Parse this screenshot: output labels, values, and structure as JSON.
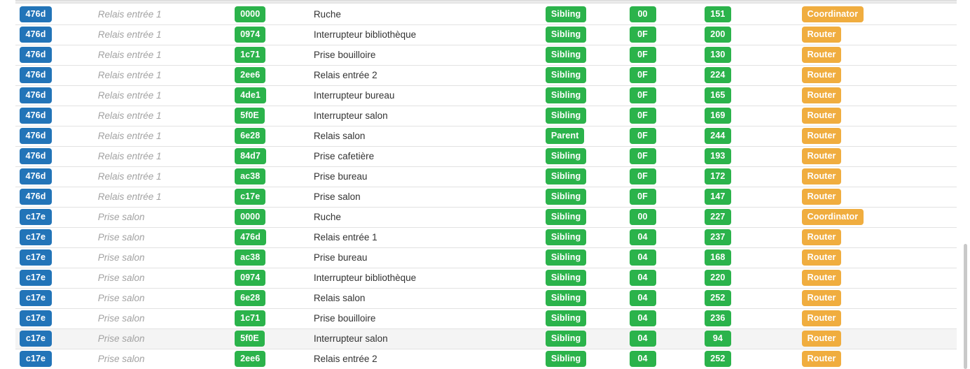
{
  "table": {
    "columns": [
      "source_id",
      "source_name",
      "target_id",
      "target_name",
      "relationship",
      "depth",
      "lqi",
      "device_type"
    ],
    "rows": [
      {
        "source_id": "476d",
        "source_name": "Relais entrée 1",
        "target_id": "0000",
        "target_name": "Ruche",
        "relationship": "Sibling",
        "depth": "00",
        "lqi": "151",
        "device_type": "Coordinator",
        "highlight": false
      },
      {
        "source_id": "476d",
        "source_name": "Relais entrée 1",
        "target_id": "0974",
        "target_name": "Interrupteur bibliothèque",
        "relationship": "Sibling",
        "depth": "0F",
        "lqi": "200",
        "device_type": "Router",
        "highlight": false
      },
      {
        "source_id": "476d",
        "source_name": "Relais entrée 1",
        "target_id": "1c71",
        "target_name": "Prise bouilloire",
        "relationship": "Sibling",
        "depth": "0F",
        "lqi": "130",
        "device_type": "Router",
        "highlight": false
      },
      {
        "source_id": "476d",
        "source_name": "Relais entrée 1",
        "target_id": "2ee6",
        "target_name": "Relais entrée 2",
        "relationship": "Sibling",
        "depth": "0F",
        "lqi": "224",
        "device_type": "Router",
        "highlight": false
      },
      {
        "source_id": "476d",
        "source_name": "Relais entrée 1",
        "target_id": "4de1",
        "target_name": "Interrupteur bureau",
        "relationship": "Sibling",
        "depth": "0F",
        "lqi": "165",
        "device_type": "Router",
        "highlight": false
      },
      {
        "source_id": "476d",
        "source_name": "Relais entrée 1",
        "target_id": "5f0E",
        "target_name": "Interrupteur salon",
        "relationship": "Sibling",
        "depth": "0F",
        "lqi": "169",
        "device_type": "Router",
        "highlight": false
      },
      {
        "source_id": "476d",
        "source_name": "Relais entrée 1",
        "target_id": "6e28",
        "target_name": "Relais salon",
        "relationship": "Parent",
        "depth": "0F",
        "lqi": "244",
        "device_type": "Router",
        "highlight": false
      },
      {
        "source_id": "476d",
        "source_name": "Relais entrée 1",
        "target_id": "84d7",
        "target_name": "Prise cafetière",
        "relationship": "Sibling",
        "depth": "0F",
        "lqi": "193",
        "device_type": "Router",
        "highlight": false
      },
      {
        "source_id": "476d",
        "source_name": "Relais entrée 1",
        "target_id": "ac38",
        "target_name": "Prise bureau",
        "relationship": "Sibling",
        "depth": "0F",
        "lqi": "172",
        "device_type": "Router",
        "highlight": false
      },
      {
        "source_id": "476d",
        "source_name": "Relais entrée 1",
        "target_id": "c17e",
        "target_name": "Prise salon",
        "relationship": "Sibling",
        "depth": "0F",
        "lqi": "147",
        "device_type": "Router",
        "highlight": false
      },
      {
        "source_id": "c17e",
        "source_name": "Prise salon",
        "target_id": "0000",
        "target_name": "Ruche",
        "relationship": "Sibling",
        "depth": "00",
        "lqi": "227",
        "device_type": "Coordinator",
        "highlight": false
      },
      {
        "source_id": "c17e",
        "source_name": "Prise salon",
        "target_id": "476d",
        "target_name": "Relais entrée 1",
        "relationship": "Sibling",
        "depth": "04",
        "lqi": "237",
        "device_type": "Router",
        "highlight": false
      },
      {
        "source_id": "c17e",
        "source_name": "Prise salon",
        "target_id": "ac38",
        "target_name": "Prise bureau",
        "relationship": "Sibling",
        "depth": "04",
        "lqi": "168",
        "device_type": "Router",
        "highlight": false
      },
      {
        "source_id": "c17e",
        "source_name": "Prise salon",
        "target_id": "0974",
        "target_name": "Interrupteur bibliothèque",
        "relationship": "Sibling",
        "depth": "04",
        "lqi": "220",
        "device_type": "Router",
        "highlight": false
      },
      {
        "source_id": "c17e",
        "source_name": "Prise salon",
        "target_id": "6e28",
        "target_name": "Relais salon",
        "relationship": "Sibling",
        "depth": "04",
        "lqi": "252",
        "device_type": "Router",
        "highlight": false
      },
      {
        "source_id": "c17e",
        "source_name": "Prise salon",
        "target_id": "1c71",
        "target_name": "Prise bouilloire",
        "relationship": "Sibling",
        "depth": "04",
        "lqi": "236",
        "device_type": "Router",
        "highlight": false
      },
      {
        "source_id": "c17e",
        "source_name": "Prise salon",
        "target_id": "5f0E",
        "target_name": "Interrupteur salon",
        "relationship": "Sibling",
        "depth": "04",
        "lqi": "94",
        "device_type": "Router",
        "highlight": true
      },
      {
        "source_id": "c17e",
        "source_name": "Prise salon",
        "target_id": "2ee6",
        "target_name": "Relais entrée 2",
        "relationship": "Sibling",
        "depth": "04",
        "lqi": "252",
        "device_type": "Router",
        "highlight": false
      }
    ]
  },
  "colors": {
    "badge_blue": "#2274b8",
    "badge_green": "#2bb34b",
    "badge_orange": "#f0ad3f",
    "row_highlight": "#f4f4f4",
    "row_border": "#e2e2e2",
    "source_name_text": "#a2a2a2",
    "target_name_text": "#333333"
  },
  "scrollbar": {
    "orientation": "vertical",
    "thumb_visible": true
  }
}
